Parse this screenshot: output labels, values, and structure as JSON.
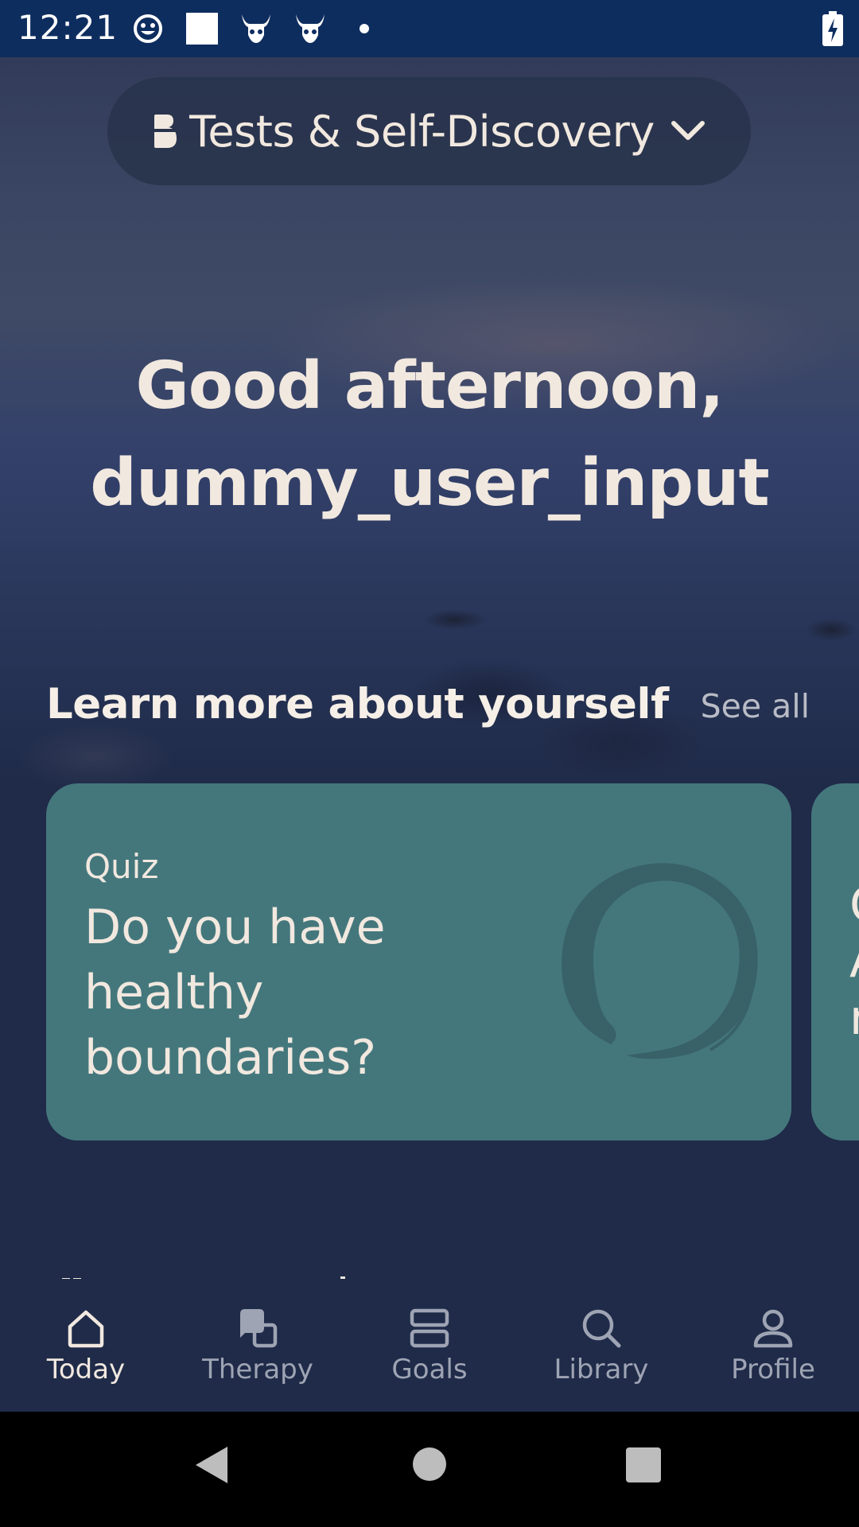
{
  "status_bar": {
    "time": "12:21",
    "icons": [
      "emoji-icon",
      "white-square-icon",
      "viking-app-icon",
      "viking-app-icon",
      "dot-icon"
    ],
    "battery": "battery-charging-icon"
  },
  "header": {
    "category_label": "Tests & Self-Discovery"
  },
  "greeting": {
    "line1": "Good afternoon,",
    "line2": "dummy_user_input"
  },
  "section": {
    "title": "Learn more about yourself",
    "see_all": "See all"
  },
  "cards": [
    {
      "type": "Quiz",
      "title": "Do you have healthy boundaries?",
      "illustration": "enso-circle-icon",
      "color": "#44777c"
    },
    {
      "type_partial": "Q",
      "title_partial": [
        "A",
        "r"
      ],
      "color": "#44777c"
    }
  ],
  "bottom_nav": {
    "items": [
      {
        "label": "Today",
        "icon": "home-icon",
        "active": true
      },
      {
        "label": "Therapy",
        "icon": "chat-bubbles-icon",
        "active": false
      },
      {
        "label": "Goals",
        "icon": "goals-icon",
        "active": false
      },
      {
        "label": "Library",
        "icon": "search-icon",
        "active": false
      },
      {
        "label": "Profile",
        "icon": "person-icon",
        "active": false
      }
    ]
  },
  "colors": {
    "background": "#1f2b49",
    "status_bar": "#0e2d5f",
    "card": "#44777c",
    "text": "#f1e8df",
    "muted_text": "#9ea4b3"
  }
}
